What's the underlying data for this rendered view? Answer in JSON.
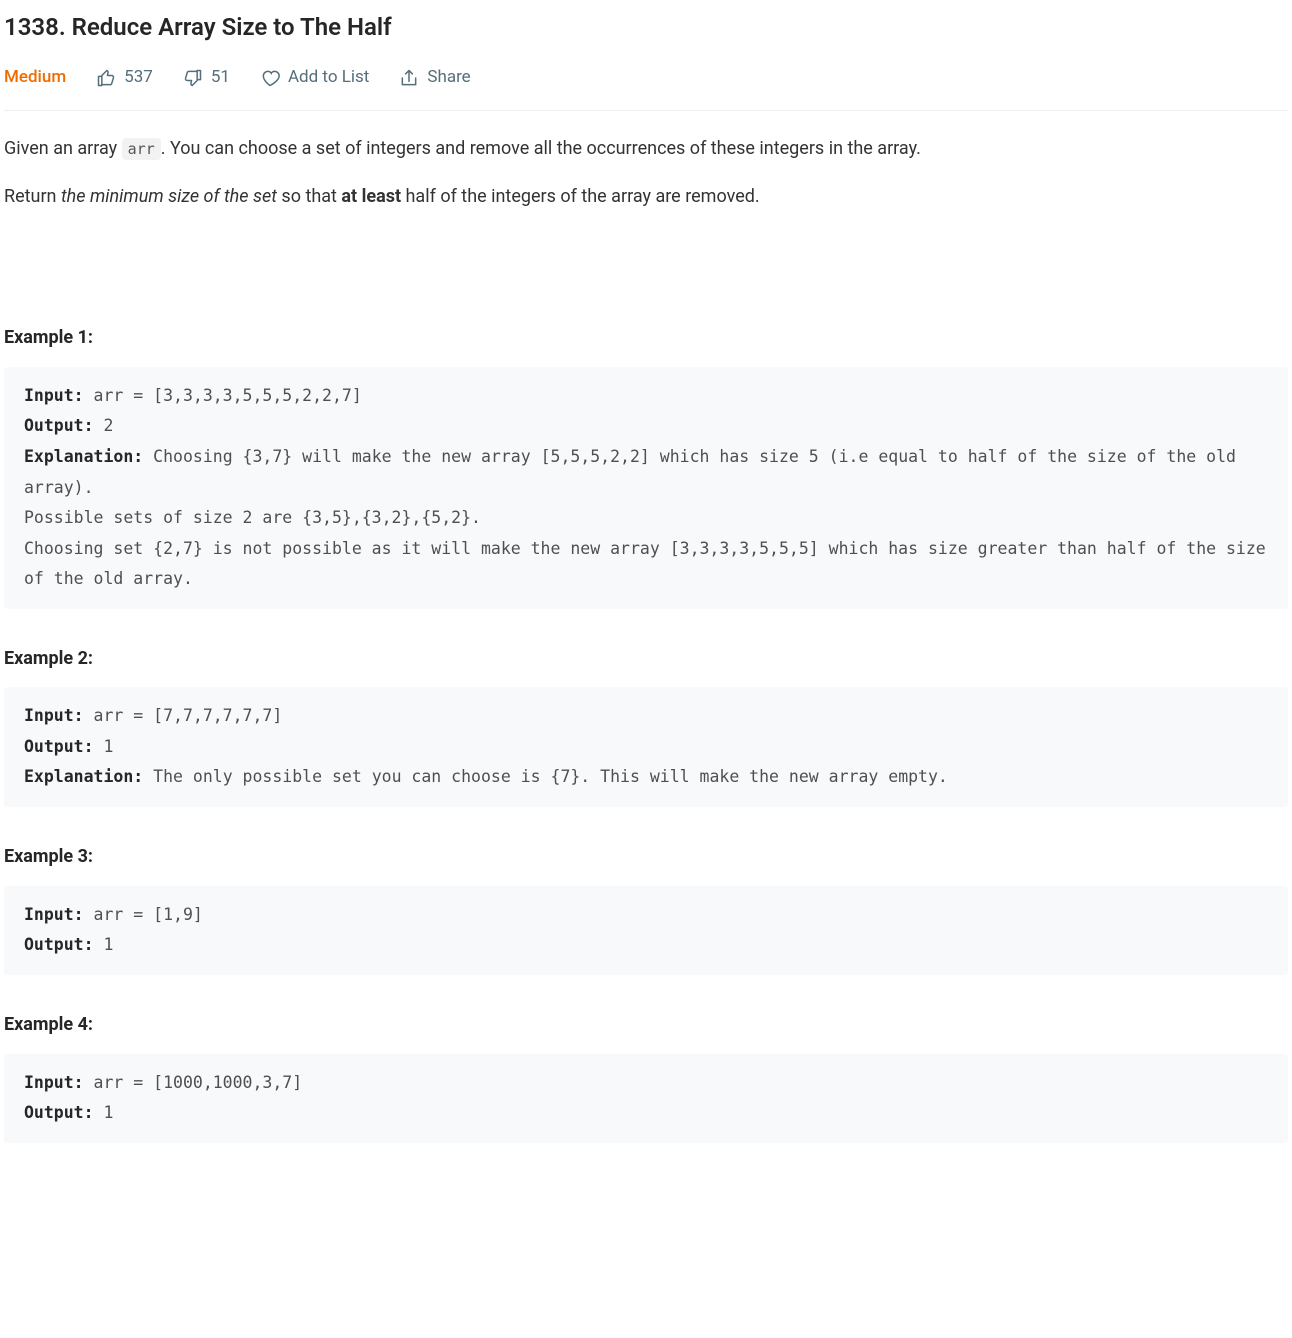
{
  "title": "1338. Reduce Array Size to The Half",
  "difficulty": "Medium",
  "meta": {
    "upvotes": "537",
    "downvotes": "51",
    "add_to_list": "Add to List",
    "share": "Share"
  },
  "description": {
    "p1_a": "Given an array ",
    "p1_code": "arr",
    "p1_b": ". You can choose a set of integers and remove all the occurrences of these integers in the array.",
    "p2_a": "Return ",
    "p2_em": "the minimum size of the set",
    "p2_b": " so that ",
    "p2_bold": "at least",
    "p2_c": " half of the integers of the array are removed."
  },
  "labels": {
    "input": "Input:",
    "output": "Output:",
    "explanation": "Explanation:"
  },
  "examples": [
    {
      "title": "Example 1:",
      "input": " arr = [3,3,3,3,5,5,5,2,2,7]",
      "output": " 2",
      "explanation": " Choosing {3,7} will make the new array [5,5,5,2,2] which has size 5 (i.e equal to half of the size of the old array).\nPossible sets of size 2 are {3,5},{3,2},{5,2}.\nChoosing set {2,7} is not possible as it will make the new array [3,3,3,3,5,5,5] which has size greater than half of the size of the old array."
    },
    {
      "title": "Example 2:",
      "input": " arr = [7,7,7,7,7,7]",
      "output": " 1",
      "explanation": " The only possible set you can choose is {7}. This will make the new array empty."
    },
    {
      "title": "Example 3:",
      "input": " arr = [1,9]",
      "output": " 1"
    },
    {
      "title": "Example 4:",
      "input": " arr = [1000,1000,3,7]",
      "output": " 1"
    }
  ]
}
